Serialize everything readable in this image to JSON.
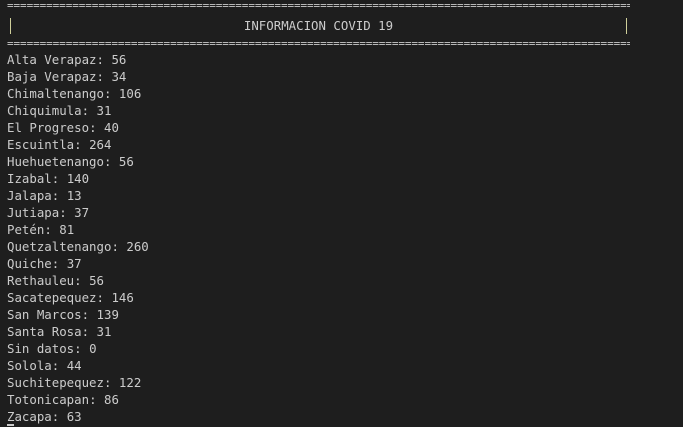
{
  "terminal": {
    "border_line": "==============================================================================================================",
    "title": "INFORMACION COVID 19",
    "border_char": "|",
    "departments": [
      {
        "name": "Alta Verapaz",
        "count": "56"
      },
      {
        "name": "Baja Verapaz",
        "count": "34"
      },
      {
        "name": "Chimaltenango",
        "count": "106"
      },
      {
        "name": "Chiquimula",
        "count": "31"
      },
      {
        "name": "El Progreso",
        "count": "40"
      },
      {
        "name": "Escuintla",
        "count": "264"
      },
      {
        "name": "Huehuetenango",
        "count": "56"
      },
      {
        "name": "Izabal",
        "count": "140"
      },
      {
        "name": "Jalapa",
        "count": "13"
      },
      {
        "name": "Jutiapa",
        "count": "37"
      },
      {
        "name": "Petén",
        "count": "81"
      },
      {
        "name": "Quetzaltenango",
        "count": "260"
      },
      {
        "name": "Quiche",
        "count": "37"
      },
      {
        "name": "Rethauleu",
        "count": "56"
      },
      {
        "name": "Sacatepequez",
        "count": "146"
      },
      {
        "name": "San Marcos",
        "count": "139"
      },
      {
        "name": "Santa Rosa",
        "count": "31"
      },
      {
        "name": "Sin datos",
        "count": "0"
      },
      {
        "name": "Solola",
        "count": "44"
      },
      {
        "name": "Suchitepequez",
        "count": "122"
      },
      {
        "name": "Totonicapan",
        "count": "86"
      },
      {
        "name": "Zacapa",
        "count": "63"
      }
    ]
  }
}
